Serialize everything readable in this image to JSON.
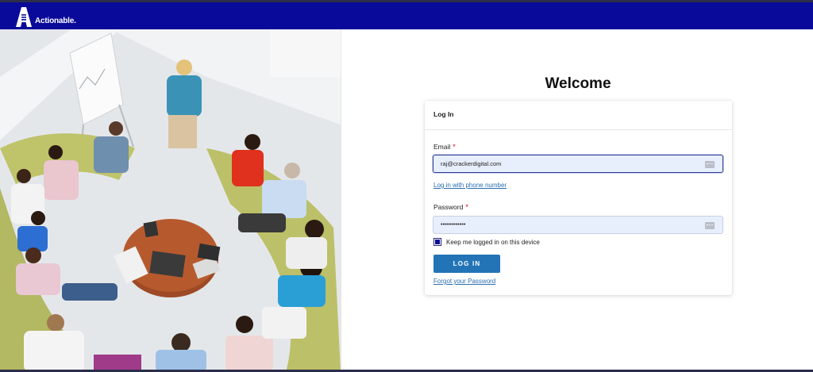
{
  "header": {
    "logo_text": "Actionable.",
    "bg_color": "#0a0a9a"
  },
  "hero_image": {
    "description_icon": "team-meeting-photo"
  },
  "welcome_title": "Welcome",
  "login": {
    "title": "Log In",
    "email_label": "Email",
    "email_value": "raj@crackerdigital.com",
    "phone_link": "Log in with phone number",
    "password_label": "Password",
    "password_value": "••••••••••••",
    "required_mark": "*",
    "remember_label": "Keep me logged in on this device",
    "remember_checked": true,
    "submit_label": "LOG IN",
    "forgot_link": "Forgot your Password",
    "button_color": "#2374b7",
    "link_color": "#2a6fb0"
  }
}
